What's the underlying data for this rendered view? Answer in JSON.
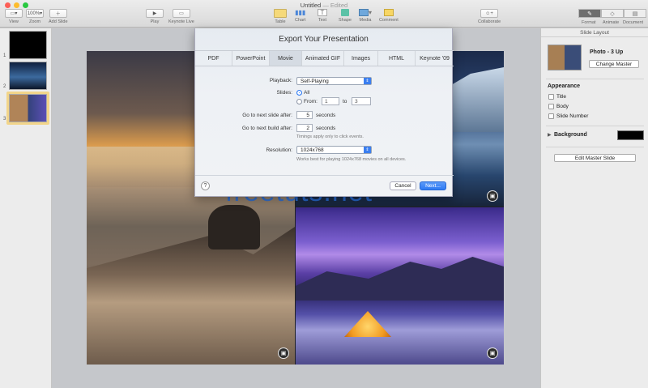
{
  "window": {
    "title": "Untitled",
    "edited": "— Edited"
  },
  "toolbar": {
    "view": "View",
    "zoom": "Zoom",
    "zoom_value": "100%",
    "add_slide": "Add Slide",
    "play": "Play",
    "keynote_live": "Keynote Live",
    "table": "Table",
    "chart": "Chart",
    "text": "Text",
    "shape": "Shape",
    "media": "Media",
    "comment": "Comment",
    "collaborate": "Collaborate",
    "format": "Format",
    "animate": "Animate",
    "document": "Document"
  },
  "navigator": {
    "slides": [
      "1",
      "2",
      "3"
    ],
    "selected": 3
  },
  "dialog": {
    "title": "Export Your Presentation",
    "tabs": [
      "PDF",
      "PowerPoint",
      "Movie",
      "Animated GIF",
      "Images",
      "HTML",
      "Keynote '09"
    ],
    "active_tab": "Movie",
    "playback_label": "Playback:",
    "playback_value": "Self-Playing",
    "slides_label": "Slides:",
    "all_label": "All",
    "from_label": "From:",
    "from_value": "1",
    "to_label": "to",
    "to_value": "3",
    "next_slide_label": "Go to next slide after:",
    "next_slide_value": "5",
    "next_slide_unit": "seconds",
    "next_build_label": "Go to next build after:",
    "next_build_value": "2",
    "next_build_unit": "seconds",
    "timing_hint": "Timings apply only to click events.",
    "resolution_label": "Resolution:",
    "resolution_value": "1024x768",
    "resolution_hint": "Works best for playing 1024x768 movies on all devices.",
    "help": "?",
    "cancel": "Cancel",
    "next": "Next..."
  },
  "watermark": "freetuts.net",
  "inspector": {
    "header": "Slide Layout",
    "master_name": "Photo - 3 Up",
    "change_master": "Change Master",
    "appearance": "Appearance",
    "title_option": "Title",
    "body_option": "Body",
    "slide_number_option": "Slide Number",
    "background": "Background",
    "edit_master": "Edit Master Slide"
  },
  "colors": {
    "accent": "#2f7af4",
    "background_swatch": "#000000"
  }
}
